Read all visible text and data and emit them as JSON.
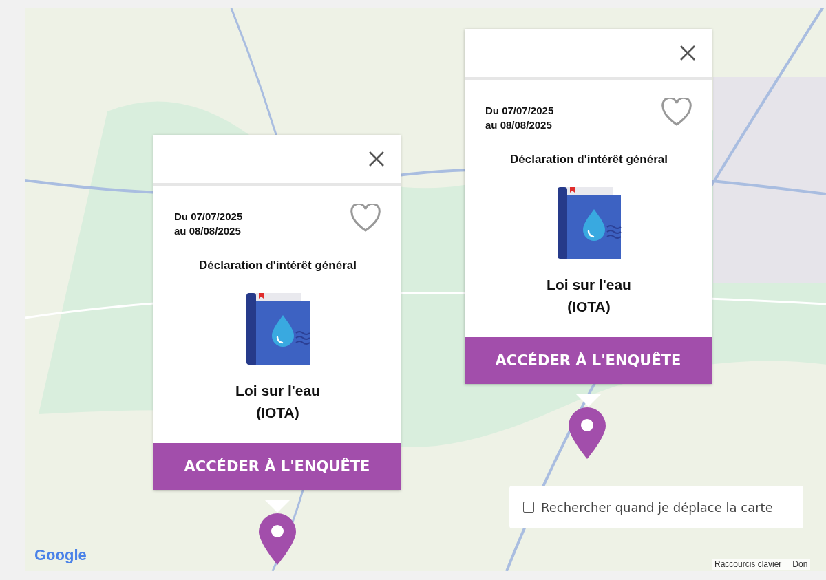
{
  "map": {
    "logo": "Google",
    "attribution": [
      "Raccourcis clavier",
      "Don"
    ],
    "search_on_move": {
      "label": "Rechercher quand je déplace la carte",
      "checked": false
    },
    "popups": [
      {
        "dates": [
          "Du 07/07/2025",
          "au 08/08/2025"
        ],
        "favorite": false,
        "category": "Déclaration d'intérêt général",
        "title": [
          "Loi sur l'eau",
          "(IOTA)"
        ],
        "button": "ACCÉDER À L'ENQUÊTE"
      },
      {
        "dates": [
          "Du 07/07/2025",
          "au 08/08/2025"
        ],
        "favorite": false,
        "category": "Déclaration d'intérêt général",
        "title": [
          "Loi sur l'eau",
          "(IOTA)"
        ],
        "button": "ACCÉDER À L'ENQUÊTE"
      }
    ]
  }
}
